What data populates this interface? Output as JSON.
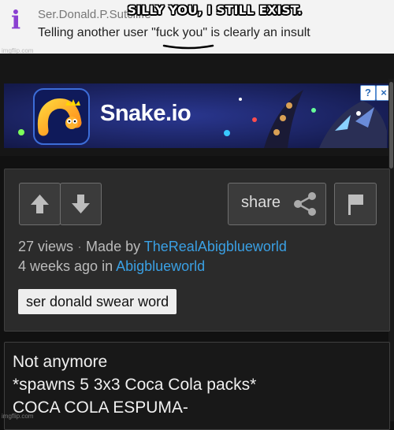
{
  "top_comment": {
    "icon_letter": "i",
    "username": "Ser.Donald.P.Sutcliffe",
    "caption": "SILLY YOU, I STILL EXIST.",
    "comment": "Telling another user \"fuck you\" is clearly an insult"
  },
  "ad": {
    "title": "Snake.io",
    "help_icon": "?",
    "close_icon": "×"
  },
  "post": {
    "share_label": "share",
    "views": "27 views",
    "made_by_prefix": "Made by",
    "author": "TheRealAbigblueworld",
    "time_prefix": "4 weeks ago in",
    "stream": "Abigblueworld",
    "tag": "ser donald swear word"
  },
  "comment_box": {
    "lines": [
      "Not anymore",
      "*spawns 5 3x3 Coca Cola packs*",
      "COCA COLA ESPUMA-"
    ]
  },
  "watermark": "imgflip.com",
  "colors": {
    "link": "#3aa0e4",
    "panel": "#2b2b2b",
    "background": "#111111",
    "ad_bg": "#1a1f60"
  }
}
